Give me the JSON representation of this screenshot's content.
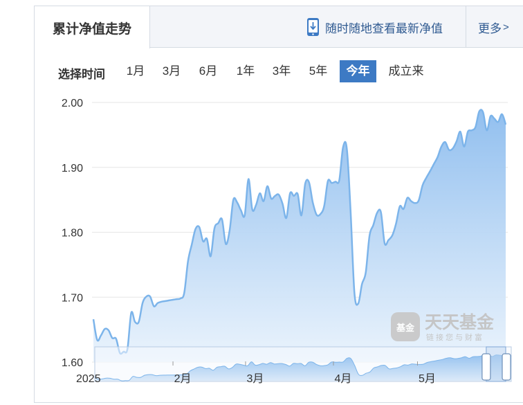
{
  "tabs": {
    "active_label": "累计净值走势",
    "mobile_link": "随时随地查看最新净值",
    "more_label": "更多",
    "more_chevron": ">"
  },
  "range": {
    "label": "选择时间",
    "options": [
      {
        "label": "1月",
        "active": false
      },
      {
        "label": "3月",
        "active": false
      },
      {
        "label": "6月",
        "active": false
      },
      {
        "label": "1年",
        "active": false
      },
      {
        "label": "3年",
        "active": false
      },
      {
        "label": "5年",
        "active": false
      },
      {
        "label": "今年",
        "active": true
      },
      {
        "label": "成立来",
        "active": false
      }
    ]
  },
  "watermark": {
    "logo_text": "基金",
    "name": "天天基金",
    "slogan": "链接您与财富"
  },
  "colors": {
    "line": "#7cb4ea",
    "area_top": "#8cbcee",
    "area_bottom": "#e8f2fc",
    "active_button": "#3d7ac4",
    "link": "#2f5a91"
  },
  "chart_data": {
    "type": "area",
    "title": "",
    "xlabel": "",
    "ylabel": "",
    "ylim": [
      1.6,
      2.0
    ],
    "yticks": [
      "2.00",
      "1.90",
      "1.80",
      "1.70",
      "1.60"
    ],
    "grid": true,
    "x_axis_labels": [
      "2025",
      "2月",
      "3月",
      "4月",
      "5月"
    ],
    "series": [
      {
        "values": [
          1.666,
          1.634,
          1.641,
          1.651,
          1.649,
          1.637,
          1.636,
          1.614,
          1.616,
          1.62,
          1.676,
          1.662,
          1.662,
          1.691,
          1.701,
          1.701,
          1.686,
          1.691,
          1.693,
          1.694,
          1.695,
          1.696,
          1.697,
          1.698,
          1.706,
          1.755,
          1.781,
          1.805,
          1.808,
          1.786,
          1.79,
          1.763,
          1.806,
          1.814,
          1.82,
          1.782,
          1.802,
          1.85,
          1.846,
          1.834,
          1.826,
          1.882,
          1.835,
          1.842,
          1.86,
          1.848,
          1.871,
          1.852,
          1.856,
          1.858,
          1.844,
          1.822,
          1.86,
          1.856,
          1.859,
          1.826,
          1.875,
          1.877,
          1.846,
          1.827,
          1.828,
          1.84,
          1.879,
          1.876,
          1.878,
          1.88,
          1.931,
          1.929,
          1.832,
          1.707,
          1.69,
          1.72,
          1.738,
          1.795,
          1.811,
          1.83,
          1.831,
          1.783,
          1.788,
          1.795,
          1.813,
          1.84,
          1.836,
          1.853,
          1.848,
          1.845,
          1.849,
          1.872,
          1.884,
          1.894,
          1.905,
          1.916,
          1.932,
          1.939,
          1.927,
          1.929,
          1.94,
          1.955,
          1.932,
          1.955,
          1.957,
          1.962,
          1.986,
          1.985,
          1.957,
          1.979,
          1.975,
          1.97,
          1.982,
          1.966
        ]
      }
    ],
    "navigator": {
      "selected_fraction_start": 0.94,
      "selected_fraction_end": 1.0
    }
  }
}
